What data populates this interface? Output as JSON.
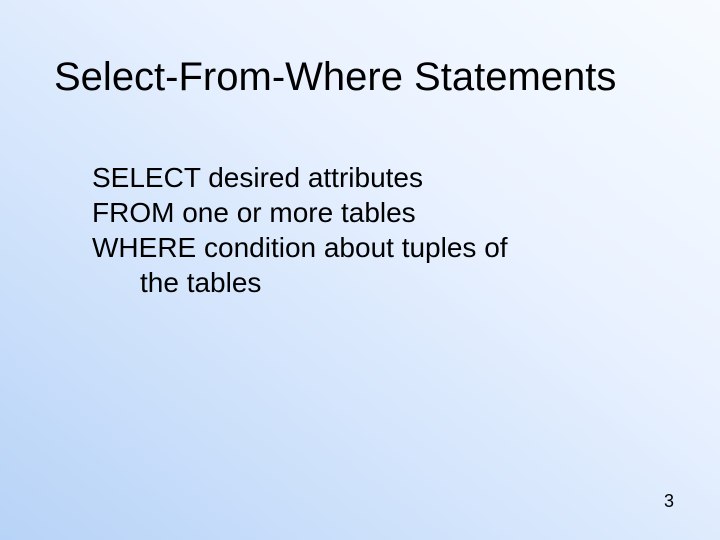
{
  "slide": {
    "title": "Select-From-Where Statements",
    "lines": {
      "l1a": "SELECT ",
      "l1b": "desired attributes",
      "l2a": "FROM ",
      "l2b": "one or more tables",
      "l3a": "WHERE ",
      "l3b": "condition about tuples of",
      "l4": "the tables"
    },
    "page_number": "3"
  }
}
